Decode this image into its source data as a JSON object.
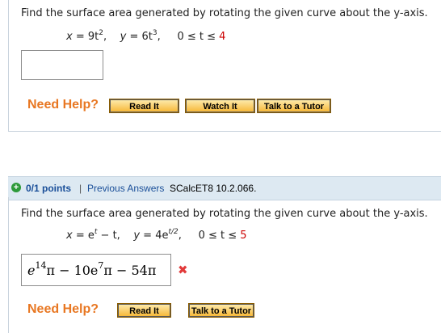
{
  "problem1": {
    "question": "Find the surface area generated by rotating the given curve about the y-axis.",
    "x_eq_lhs": "x",
    "x_eq_rhs": "= 9t",
    "x_exp": "2",
    "y_eq_lhs": "y",
    "y_eq_rhs": "= 6t",
    "y_exp": "3",
    "range_prefix": "0 ≤ t ≤ ",
    "range_end": "4",
    "answer_value": "",
    "need_help": "Need Help?",
    "read_label": "Read It",
    "watch_label": "Watch It",
    "tutor_label": "Talk to a Tutor"
  },
  "problem2": {
    "status_icon": "plus-icon",
    "points": "0/1 points",
    "separator": "|",
    "previous_answers": "Previous Answers",
    "reference": "SCalcET8 10.2.066.",
    "question": "Find the surface area generated by rotating the given curve about the y-axis.",
    "x_eq_lhs": "x",
    "x_eq_rhs": "= e",
    "x_exp": "t",
    "x_tail": " − t,",
    "y_eq_lhs": "y",
    "y_eq_rhs": "= 4e",
    "y_exp": "t/2",
    "y_tail": ",",
    "range_prefix": "0 ≤ t ≤ ",
    "range_end": "5",
    "answer": {
      "e1": "e",
      "exp1": "14",
      "t1": "π − 10e",
      "exp2": "7",
      "t2": "π − 54π"
    },
    "wrong_mark": "✖",
    "need_help": "Need Help?",
    "read_label": "Read It",
    "tutor_label": "Talk to a Tutor"
  }
}
